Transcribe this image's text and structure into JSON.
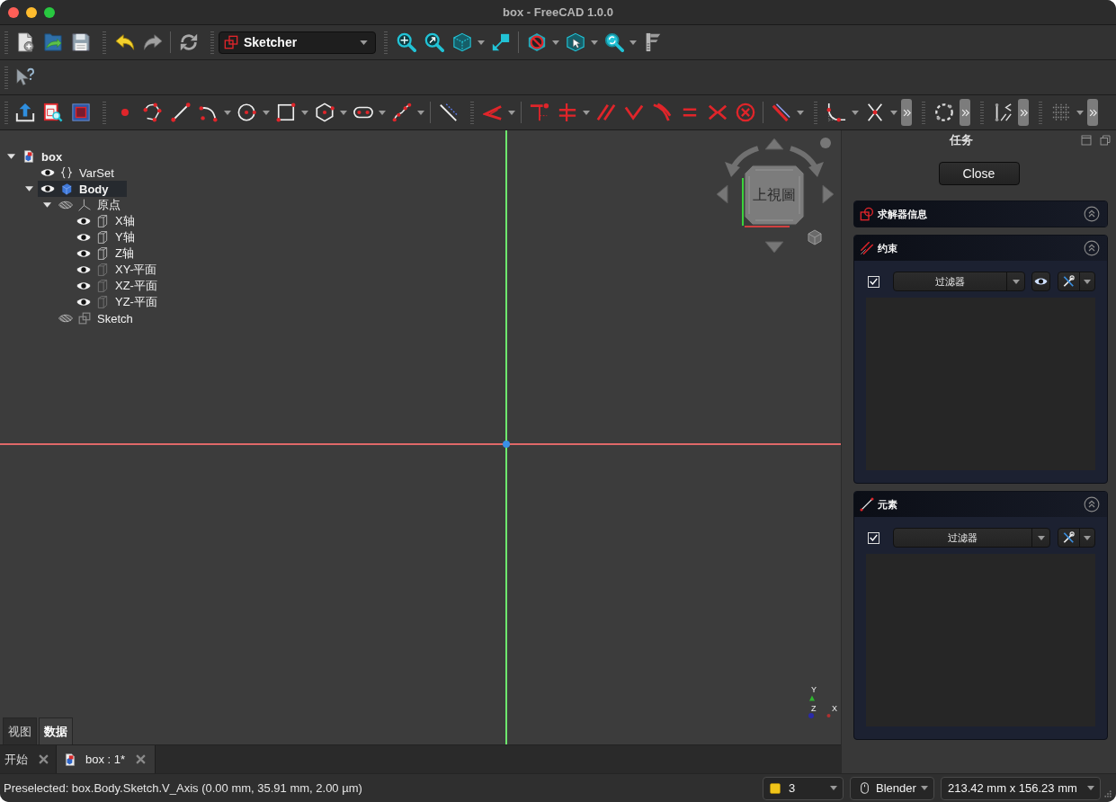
{
  "window": {
    "title": "box - FreeCAD 1.0.0"
  },
  "workbench_selector": {
    "value": "Sketcher"
  },
  "tree": {
    "label": "box",
    "expanded": true,
    "selected": false,
    "children": [
      {
        "label": "VarSet",
        "kind": "varset",
        "visible": true,
        "active": false,
        "selected": false
      },
      {
        "label": "Body",
        "kind": "body",
        "visible": true,
        "active": true,
        "selected": true,
        "expanded": true,
        "children": [
          {
            "label": "原点",
            "kind": "origin",
            "visible": false,
            "active": false,
            "selected": false,
            "expanded": true,
            "children": [
              {
                "label": "X轴",
                "kind": "axis",
                "visible": true,
                "active": false,
                "selected": false
              },
              {
                "label": "Y轴",
                "kind": "axis",
                "visible": true,
                "active": false,
                "selected": false
              },
              {
                "label": "Z轴",
                "kind": "axis",
                "visible": true,
                "active": false,
                "selected": false
              },
              {
                "label": "XY-平面",
                "kind": "plane",
                "visible": true,
                "active": false,
                "selected": false
              },
              {
                "label": "XZ-平面",
                "kind": "plane",
                "visible": true,
                "active": false,
                "selected": false
              },
              {
                "label": "YZ-平面",
                "kind": "plane",
                "visible": true,
                "active": false,
                "selected": false
              }
            ]
          },
          {
            "label": "Sketch",
            "kind": "sketch",
            "visible": false,
            "active": false,
            "selected": false
          }
        ]
      }
    ]
  },
  "combo_tabs": [
    {
      "label": "视图",
      "selected": false
    },
    {
      "label": "数据",
      "selected": true
    }
  ],
  "viewport": {
    "nav_cube_label": "上視圖",
    "axis_labels": [
      "Y",
      "Z",
      "X"
    ]
  },
  "task_panel": {
    "title": "任务",
    "close_button": "Close",
    "sections": [
      {
        "kind": "solver",
        "title": "求解器信息",
        "expanded": false
      },
      {
        "kind": "constraints",
        "title": "约束",
        "expanded": true,
        "filter": {
          "checked": true,
          "label": "过滤器"
        }
      },
      {
        "kind": "elements",
        "title": "元素",
        "expanded": true,
        "filter": {
          "checked": true,
          "label": "过滤器"
        }
      }
    ]
  },
  "document_tabs": [
    {
      "label": "开始",
      "kind": "start",
      "selected": false
    },
    {
      "label": "box : 1*",
      "kind": "document",
      "selected": true
    }
  ],
  "status_bar": {
    "message": "Preselected: box.Body.Sketch.V_Axis (0.00 mm, 35.91 mm, 2.00 µm)",
    "widgets": [
      {
        "kind": "notifications",
        "label": "3"
      },
      {
        "kind": "navigation_style",
        "label": "Blender"
      },
      {
        "kind": "view_size",
        "label": "213.42 mm x 156.23 mm"
      }
    ]
  }
}
